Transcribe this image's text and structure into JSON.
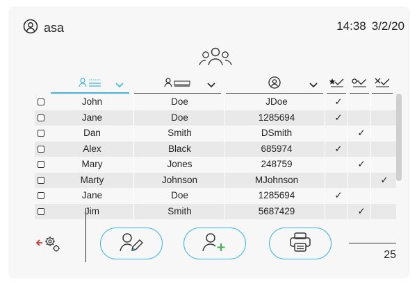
{
  "header": {
    "user": "asa",
    "time": "14:38",
    "date": "3/2/20"
  },
  "colors": {
    "accent": "#39b7e8",
    "text": "#222222",
    "alt_row": "#e9e9e9",
    "add_plus": "#3bb54a"
  },
  "columns": [
    {
      "name": "first-name",
      "icon": "user-name-icon"
    },
    {
      "name": "last-name",
      "icon": "user-card-icon"
    },
    {
      "name": "username",
      "icon": "user-circle-icon"
    },
    {
      "name": "role-1",
      "icon": "star-check-icon"
    },
    {
      "name": "role-2",
      "icon": "key-check-icon"
    },
    {
      "name": "role-3",
      "icon": "tools-check-icon"
    }
  ],
  "rows": [
    {
      "first": "John",
      "last": "Doe",
      "id": "JDoe",
      "r1": "✓",
      "r2": "",
      "r3": ""
    },
    {
      "first": "Jane",
      "last": "Doe",
      "id": "1285694",
      "r1": "✓",
      "r2": "",
      "r3": ""
    },
    {
      "first": "Dan",
      "last": "Smith",
      "id": "DSmith",
      "r1": "",
      "r2": "✓",
      "r3": ""
    },
    {
      "first": "Alex",
      "last": "Black",
      "id": "685974",
      "r1": "✓",
      "r2": "",
      "r3": ""
    },
    {
      "first": "Mary",
      "last": "Jones",
      "id": "248759",
      "r1": "",
      "r2": "✓",
      "r3": ""
    },
    {
      "first": "Marty",
      "last": "Johnson",
      "id": "MJohnson",
      "r1": "",
      "r2": "",
      "r3": "✓"
    },
    {
      "first": "Jane",
      "last": "Doe",
      "id": "1285694",
      "r1": "✓",
      "r2": "",
      "r3": ""
    },
    {
      "first": "Jim",
      "last": "Smith",
      "id": "5687429",
      "r1": "",
      "r2": "✓",
      "r3": ""
    }
  ],
  "footer": {
    "buttons": [
      "settings-back-icon",
      "edit-user-icon",
      "add-user-icon",
      "print-icon"
    ],
    "count": "25"
  }
}
